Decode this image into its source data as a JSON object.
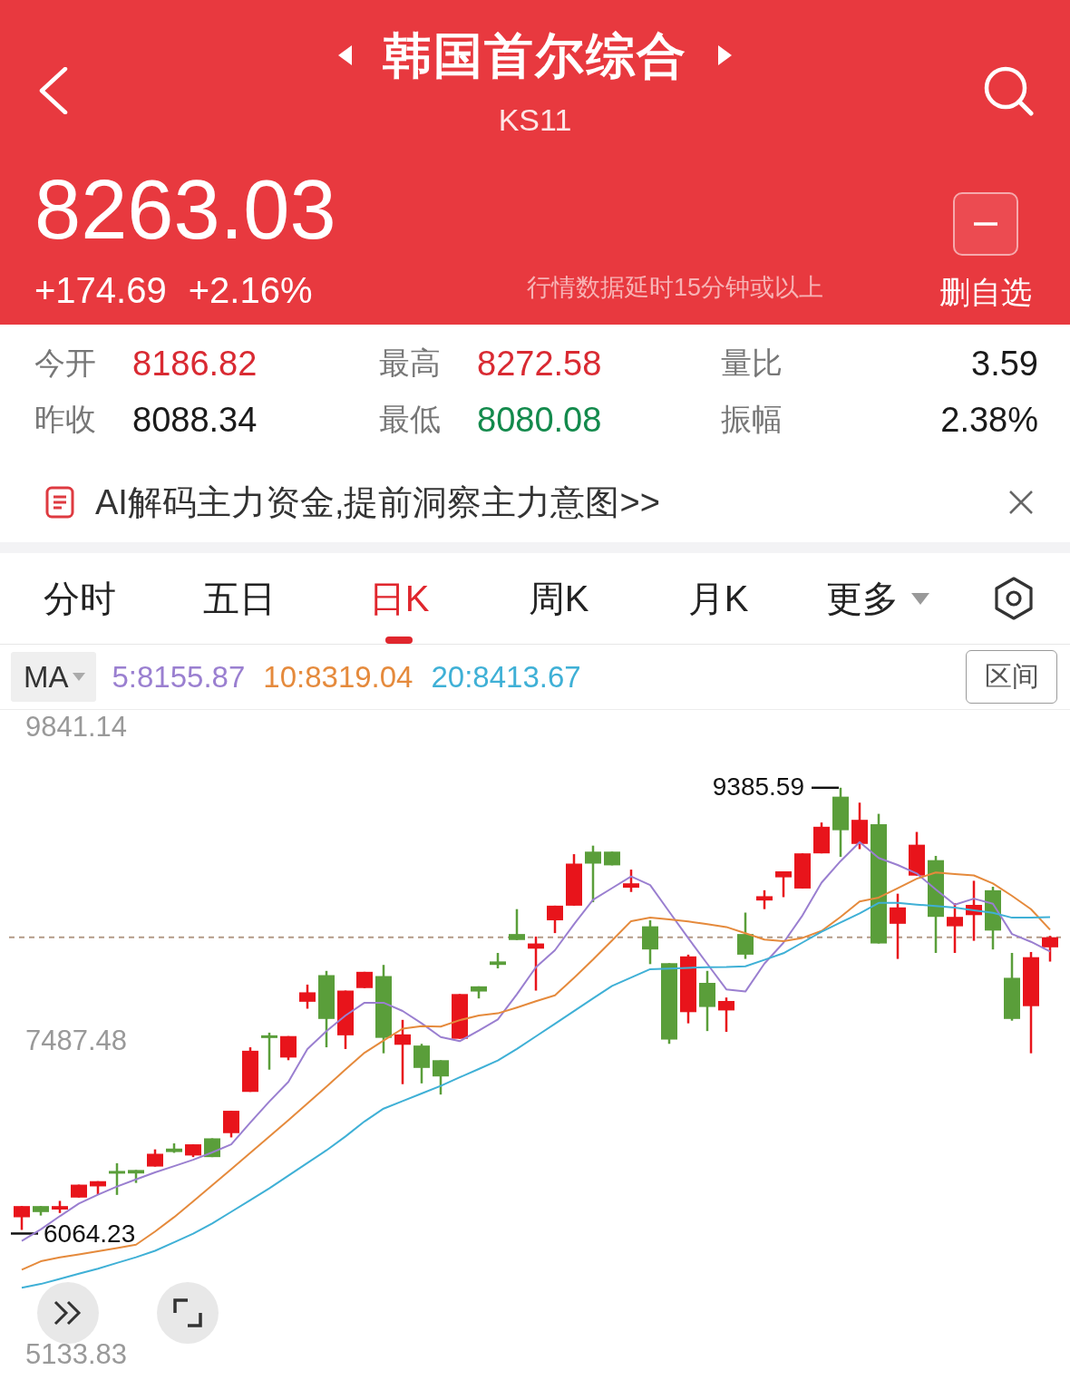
{
  "header": {
    "title": "韩国首尔综合",
    "code": "KS11",
    "price": "8263.03",
    "change": "+174.69",
    "change_percent": "+2.16%",
    "delay_notice": "行情数据延时15分钟或以上",
    "watchlist_button": "删自选"
  },
  "stats": [
    {
      "label": "今开",
      "value": "8186.82",
      "color": "#d92a32"
    },
    {
      "label": "最高",
      "value": "8272.58",
      "color": "#d92a32"
    },
    {
      "label": "量比",
      "value": "3.59",
      "color": "#1a1a1a"
    },
    {
      "label": "昨收",
      "value": "8088.34",
      "color": "#1a1a1a"
    },
    {
      "label": "最低",
      "value": "8080.08",
      "color": "#138a4c"
    },
    {
      "label": "振幅",
      "value": "2.38%",
      "color": "#1a1a1a"
    }
  ],
  "banner": {
    "text": "AI解码主力资金,提前洞察主力意图>>"
  },
  "tabs": [
    {
      "label": "分时",
      "selected": false,
      "kind": "plain"
    },
    {
      "label": "五日",
      "selected": false,
      "kind": "plain"
    },
    {
      "label": "日K",
      "selected": true,
      "kind": "plain"
    },
    {
      "label": "周K",
      "selected": false,
      "kind": "plain"
    },
    {
      "label": "月K",
      "selected": false,
      "kind": "plain"
    },
    {
      "label": "更多",
      "selected": false,
      "kind": "dropdown"
    }
  ],
  "indicator_bar": {
    "selector": "MA",
    "ma_values": [
      {
        "label": "5:8155.87",
        "color": "#9a7fd0"
      },
      {
        "label": "10:8319.04",
        "color": "#e58a3c"
      },
      {
        "label": "20:8413.67",
        "color": "#3fb0d6"
      }
    ],
    "range_button": "区间"
  },
  "chart": {
    "chart_data": {
      "type": "line",
      "ylim": [
        4949.9,
        9970.57
      ],
      "yticks": [
        {
          "value": 9841.14,
          "label": "9841.14"
        },
        {
          "value": 7487.48,
          "label": "7487.48"
        },
        {
          "value": 5133.83,
          "label": "5133.83"
        }
      ],
      "series": [
        {
          "color": "#9a7fd0",
          "values": [
            5981,
            6068,
            6167,
            6262,
            6328,
            6390,
            6444,
            6496,
            6543,
            6591,
            6646,
            6707,
            6870,
            7028,
            7176,
            7423,
            7557,
            7675,
            7771,
            7771,
            7709,
            7616,
            7513,
            7482,
            7561,
            7645,
            7834,
            8038,
            8165,
            8361,
            8544,
            8632,
            8719,
            8655,
            8455,
            8256,
            8063,
            7871,
            7855,
            8065,
            8221,
            8427,
            8673,
            8835,
            8977,
            8858,
            8806,
            8742,
            8622,
            8508,
            8553,
            8515,
            8287,
            8229,
            8156
          ]
        },
        {
          "color": "#e58a3c",
          "values": [
            5765,
            5828,
            5857,
            5880,
            5904,
            5928,
            5953,
            6052,
            6160,
            6278,
            6399,
            6520,
            6643,
            6766,
            6888,
            7014,
            7141,
            7269,
            7395,
            7486,
            7576,
            7595,
            7591,
            7640,
            7675,
            7691,
            7735,
            7782,
            7827,
            7958,
            8095,
            8239,
            8384,
            8410,
            8396,
            8382,
            8361,
            8340,
            8293,
            8245,
            8233,
            8258,
            8310,
            8415,
            8532,
            8561,
            8631,
            8703,
            8749,
            8738,
            8727,
            8667,
            8574,
            8474,
            8319
          ]
        },
        {
          "color": "#3fb0d6",
          "values": [
            5630,
            5658,
            5696,
            5735,
            5773,
            5816,
            5859,
            5907,
            5971,
            6035,
            6113,
            6200,
            6288,
            6376,
            6472,
            6567,
            6662,
            6766,
            6879,
            6975,
            7032,
            7089,
            7146,
            7210,
            7273,
            7337,
            7424,
            7518,
            7613,
            7708,
            7803,
            7897,
            7960,
            8023,
            8028,
            8033,
            8037,
            8039,
            8045,
            8093,
            8143,
            8223,
            8304,
            8374,
            8442,
            8521,
            8521,
            8508,
            8497,
            8486,
            8466,
            8446,
            8410,
            8410,
            8414
          ]
        }
      ]
    },
    "high_marker": "9385.59",
    "low_marker": "6064.23"
  }
}
